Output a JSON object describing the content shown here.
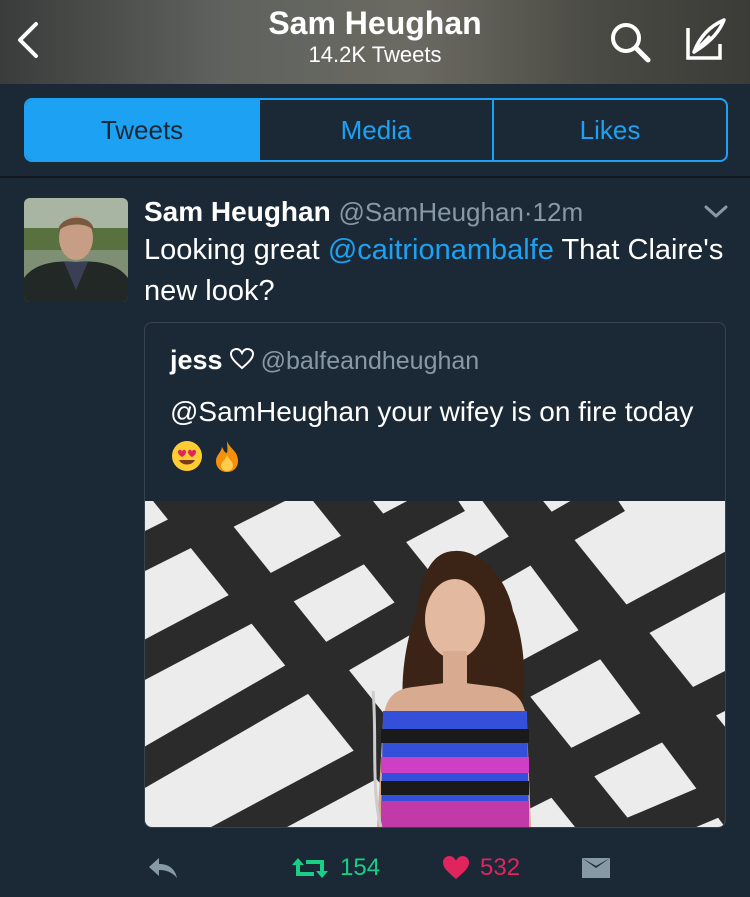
{
  "header": {
    "title": "Sam Heughan",
    "subtitle": "14.2K Tweets"
  },
  "tabs": [
    {
      "label": "Tweets",
      "active": true
    },
    {
      "label": "Media",
      "active": false
    },
    {
      "label": "Likes",
      "active": false
    }
  ],
  "tweet": {
    "name": "Sam Heughan",
    "handle": "@SamHeughan",
    "separator": "·",
    "time": "12m",
    "text_before": "Looking great ",
    "mention": "@caitrionambalfe",
    "text_after": " That Claire's new look?",
    "quote": {
      "name": "jess",
      "handle": "@balfeandheughan",
      "text": "@SamHeughan your wifey is on fire today"
    },
    "retweets": "154",
    "likes": "532"
  },
  "colors": {
    "background": "#1b2836",
    "accent": "#1da1f2",
    "retweet": "#19cf86",
    "like": "#e0245e",
    "secondary_text": "#8899a6"
  }
}
